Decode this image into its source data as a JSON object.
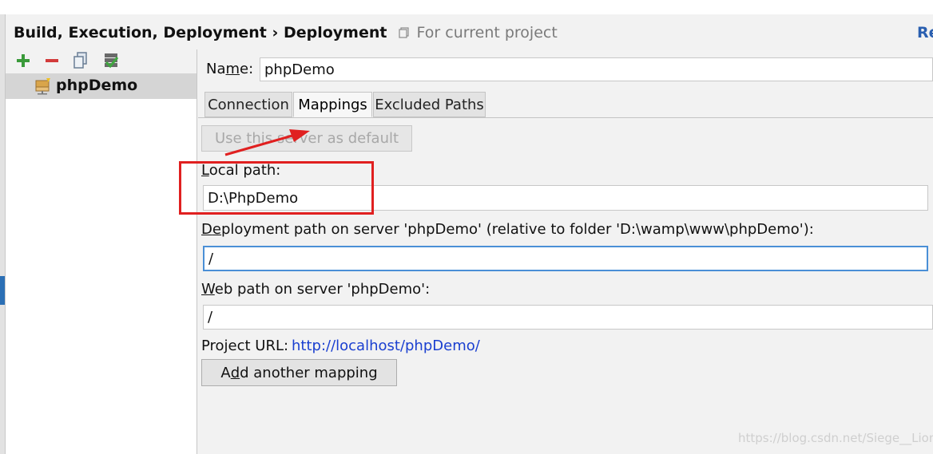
{
  "header": {
    "breadcrumb": "Build, Execution, Deployment › Deployment",
    "scope": "For current project",
    "reset": "Re"
  },
  "toolbar": {
    "items": [
      {
        "name": "add-icon",
        "color": "#3a9a3a"
      },
      {
        "name": "remove-icon",
        "color": "#d23b3b"
      },
      {
        "name": "copy-icon",
        "color": "#6a7e95"
      },
      {
        "name": "use-as-default-icon",
        "color": "#5a8a4a"
      }
    ]
  },
  "servers": [
    {
      "label": "phpDemo",
      "selected": true
    }
  ],
  "form": {
    "name_label_pre": "Na",
    "name_label_u": "m",
    "name_label_post": "e:",
    "name_value": "phpDemo",
    "tabs": [
      {
        "label": "Connection",
        "active": false
      },
      {
        "label": "Mappings",
        "active": true
      },
      {
        "label": "Excluded Paths",
        "active": false
      }
    ],
    "default_button": "Use this server as default",
    "local_path_u": "L",
    "local_path_rest": "ocal path:",
    "local_path_value": "D:\\PhpDemo",
    "deploy_path_u": "D",
    "deploy_path_u2": "e",
    "deploy_path_rest": "ployment path on server 'phpDemo' (relative to folder 'D:\\wamp\\www\\phpDemo'):",
    "deploy_path_value": "/",
    "web_path_u": "W",
    "web_path_rest": "eb path on server 'phpDemo':",
    "web_path_value": "/",
    "project_url_label": "Project URL:",
    "project_url": "http://localhost/phpDemo/",
    "add_mapping_pre": "A",
    "add_mapping_u": "d",
    "add_mapping_post": "d another mapping"
  },
  "watermark": "https://blog.csdn.net/Siege__Lion",
  "colors": {
    "accent": "#2b6fb5",
    "annotation": "#e02020",
    "link": "#1a3fd0"
  }
}
